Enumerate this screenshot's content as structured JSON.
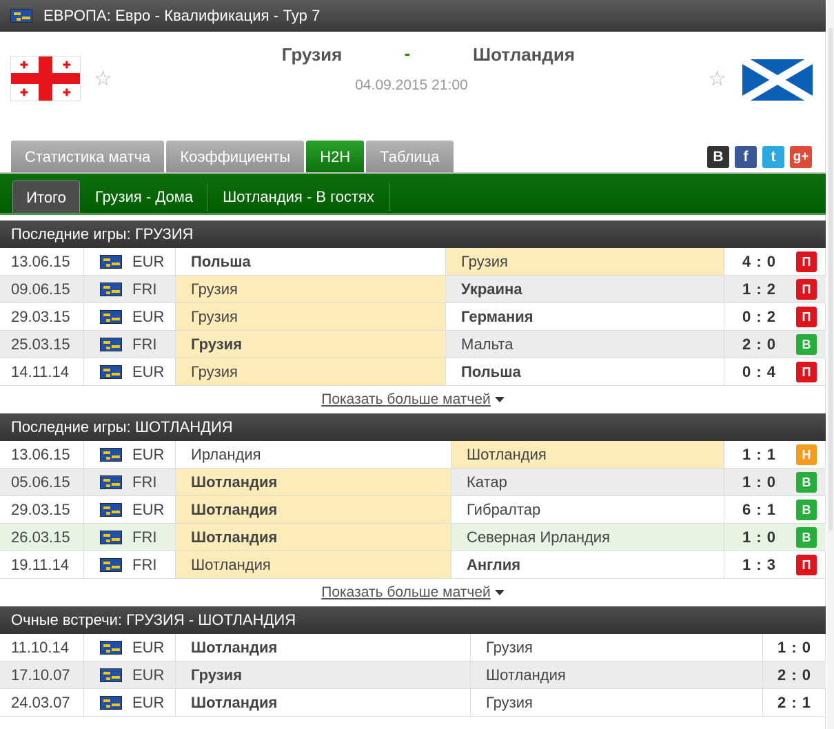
{
  "header": {
    "title": "ЕВРОПА: Евро - Квалификация - Тур 7"
  },
  "match": {
    "home_team": "Грузия",
    "away_team": "Шотландия",
    "separator": "-",
    "datetime": "04.09.2015 21:00"
  },
  "tabs": [
    {
      "label": "Статистика матча",
      "active": false
    },
    {
      "label": "Коэффициенты",
      "active": false
    },
    {
      "label": "H2H",
      "active": true
    },
    {
      "label": "Таблица",
      "active": false
    }
  ],
  "social": [
    {
      "label": "B",
      "icon": "vk-icon",
      "color": "#333333"
    },
    {
      "label": "f",
      "icon": "facebook-icon",
      "color": "#3b5998"
    },
    {
      "label": "t",
      "icon": "twitter-icon",
      "color": "#2aa9e0"
    },
    {
      "label": "g+",
      "icon": "google-plus-icon",
      "color": "#dd4b39"
    }
  ],
  "subtabs": [
    {
      "label": "Итого",
      "active": true
    },
    {
      "label": "Грузия - Дома",
      "active": false
    },
    {
      "label": "Шотландия - В гостях",
      "active": false
    }
  ],
  "sections": [
    {
      "title": "Последние игры: ГРУЗИЯ",
      "more": "Показать больше матчей",
      "rows": [
        {
          "date": "13.06.15",
          "comp": "EUR",
          "home": "Польша",
          "away": "Грузия",
          "score": "4 : 0",
          "result": "П"
        },
        {
          "date": "09.06.15",
          "comp": "FRI",
          "home": "Грузия",
          "away": "Украина",
          "score": "1 : 2",
          "result": "П"
        },
        {
          "date": "29.03.15",
          "comp": "EUR",
          "home": "Грузия",
          "away": "Германия",
          "score": "0 : 2",
          "result": "П"
        },
        {
          "date": "25.03.15",
          "comp": "FRI",
          "home": "Грузия",
          "away": "Мальта",
          "score": "2 : 0",
          "result": "В"
        },
        {
          "date": "14.11.14",
          "comp": "EUR",
          "home": "Грузия",
          "away": "Польша",
          "score": "0 : 4",
          "result": "П"
        }
      ]
    },
    {
      "title": "Последние игры: ШОТЛАНДИЯ",
      "more": "Показать больше матчей",
      "rows": [
        {
          "date": "13.06.15",
          "comp": "EUR",
          "home": "Ирландия",
          "away": "Шотландия",
          "score": "1 : 1",
          "result": "Н"
        },
        {
          "date": "05.06.15",
          "comp": "FRI",
          "home": "Шотландия",
          "away": "Катар",
          "score": "1 : 0",
          "result": "В"
        },
        {
          "date": "29.03.15",
          "comp": "EUR",
          "home": "Шотландия",
          "away": "Гибралтар",
          "score": "6 : 1",
          "result": "В"
        },
        {
          "date": "26.03.15",
          "comp": "FRI",
          "home": "Шотландия",
          "away": "Северная Ирландия",
          "score": "1 : 0",
          "result": "В"
        },
        {
          "date": "19.11.14",
          "comp": "FRI",
          "home": "Шотландия",
          "away": "Англия",
          "score": "1 : 3",
          "result": "П"
        }
      ]
    },
    {
      "title": "Очные встречи: ГРУЗИЯ - ШОТЛАНДИЯ",
      "rows": [
        {
          "date": "11.10.14",
          "comp": "EUR",
          "home": "Шотландия",
          "away": "Грузия",
          "score": "1 : 0"
        },
        {
          "date": "17.10.07",
          "comp": "EUR",
          "home": "Грузия",
          "away": "Шотландия",
          "score": "2 : 0"
        },
        {
          "date": "24.03.07",
          "comp": "EUR",
          "home": "Шотландия",
          "away": "Грузия",
          "score": "2 : 1"
        }
      ]
    }
  ],
  "colors": {
    "loss": "#e0141c",
    "win": "#27ae3c",
    "draw": "#f39c1e",
    "team_highlight": "#fcecb9",
    "accent_green": "#0d6e0d"
  }
}
